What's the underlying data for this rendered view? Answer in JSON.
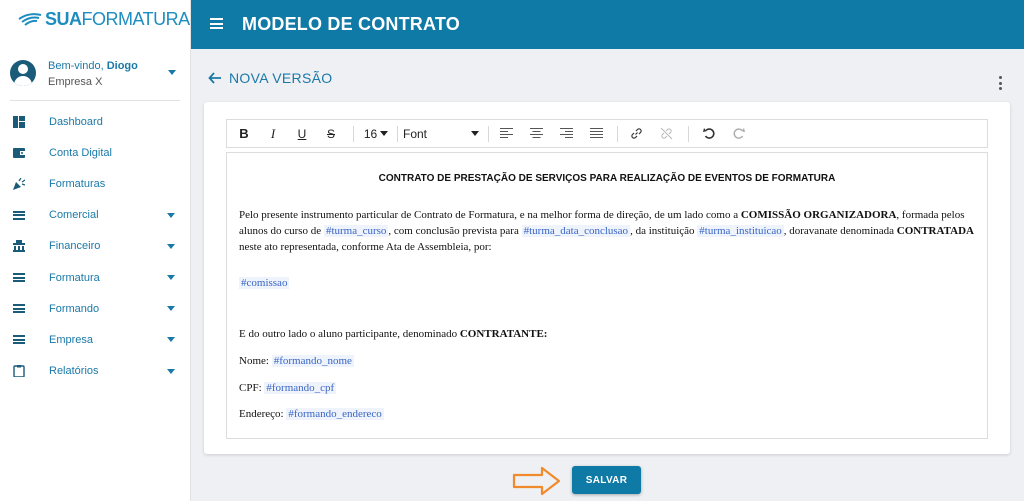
{
  "brand": {
    "strong": "SUA",
    "light": "FORMATURA",
    "color": "#1d8dc0"
  },
  "user": {
    "greeting": "Bem-vindo,",
    "name": "Diogo",
    "company": "Empresa X"
  },
  "sidebar": {
    "items": [
      {
        "label": "Dashboard",
        "icon": "dashboard-icon",
        "expandable": false
      },
      {
        "label": "Conta Digital",
        "icon": "wallet-icon",
        "expandable": false
      },
      {
        "label": "Formaturas",
        "icon": "party-popper-icon",
        "expandable": false
      },
      {
        "label": "Comercial",
        "icon": "list-icon",
        "expandable": true
      },
      {
        "label": "Financeiro",
        "icon": "bank-icon",
        "expandable": true
      },
      {
        "label": "Formatura",
        "icon": "list-icon",
        "expandable": true
      },
      {
        "label": "Formando",
        "icon": "list-icon",
        "expandable": true
      },
      {
        "label": "Empresa",
        "icon": "list-icon",
        "expandable": true
      },
      {
        "label": "Relatórios",
        "icon": "clipboard-icon",
        "expandable": true
      }
    ]
  },
  "header": {
    "title": "MODELO DE CONTRATO",
    "color": "#0f7aa5"
  },
  "subheader": {
    "title": "NOVA VERSÃO"
  },
  "toolbar": {
    "bold": "B",
    "italic": "I",
    "underline": "U",
    "strike": "S",
    "font_size": "16",
    "font_family": "Font"
  },
  "document": {
    "title": "CONTRATO DE PRESTAÇÃO DE SERVIÇOS PARA REALIZAÇÃO DE EVENTOS DE FORMATURA",
    "p1": {
      "t1": "Pelo presente instrumento particular de Contrato de Formatura, e na melhor forma de direção, de um lado como a ",
      "b1": "COMISSÃO ORGANIZADORA",
      "t2": ", formada pelos alunos do curso de ",
      "tag1": "#turma_curso",
      "t3": ", com conclusão prevista para ",
      "tag2": "#turma_data_conclusao",
      "t4": ", da instituição ",
      "tag3": "#turma_instituicao",
      "t5": ",  doravanate denominada ",
      "b2": "CONTRATADA",
      "t6": " neste ato representada, conforme Ata de Assembleia, por:"
    },
    "comissao_tag": "#comissao",
    "p2": {
      "text": "E do outro lado o aluno participante, denominado ",
      "bold": "CONTRATANTE:"
    },
    "fields": [
      {
        "label": "Nome:",
        "tag": "#formando_nome"
      },
      {
        "label": "CPF:",
        "tag": "#formando_cpf"
      },
      {
        "label": "Endereço:",
        "tag": "#formando_endereco"
      }
    ]
  },
  "save_button": {
    "label": "SALVAR"
  },
  "colors": {
    "accent": "#0f7aa5",
    "tag_text": "#3a66c4",
    "tag_bg": "#eef3fc",
    "arrow": "#f08a2c"
  }
}
